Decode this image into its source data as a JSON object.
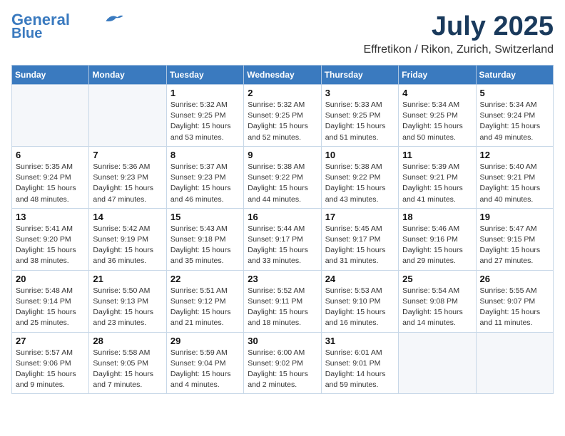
{
  "header": {
    "logo_line1": "General",
    "logo_line2": "Blue",
    "month": "July 2025",
    "location": "Effretikon / Rikon, Zurich, Switzerland"
  },
  "weekdays": [
    "Sunday",
    "Monday",
    "Tuesday",
    "Wednesday",
    "Thursday",
    "Friday",
    "Saturday"
  ],
  "weeks": [
    [
      {
        "day": "",
        "info": ""
      },
      {
        "day": "",
        "info": ""
      },
      {
        "day": "1",
        "info": "Sunrise: 5:32 AM\nSunset: 9:25 PM\nDaylight: 15 hours\nand 53 minutes."
      },
      {
        "day": "2",
        "info": "Sunrise: 5:32 AM\nSunset: 9:25 PM\nDaylight: 15 hours\nand 52 minutes."
      },
      {
        "day": "3",
        "info": "Sunrise: 5:33 AM\nSunset: 9:25 PM\nDaylight: 15 hours\nand 51 minutes."
      },
      {
        "day": "4",
        "info": "Sunrise: 5:34 AM\nSunset: 9:25 PM\nDaylight: 15 hours\nand 50 minutes."
      },
      {
        "day": "5",
        "info": "Sunrise: 5:34 AM\nSunset: 9:24 PM\nDaylight: 15 hours\nand 49 minutes."
      }
    ],
    [
      {
        "day": "6",
        "info": "Sunrise: 5:35 AM\nSunset: 9:24 PM\nDaylight: 15 hours\nand 48 minutes."
      },
      {
        "day": "7",
        "info": "Sunrise: 5:36 AM\nSunset: 9:23 PM\nDaylight: 15 hours\nand 47 minutes."
      },
      {
        "day": "8",
        "info": "Sunrise: 5:37 AM\nSunset: 9:23 PM\nDaylight: 15 hours\nand 46 minutes."
      },
      {
        "day": "9",
        "info": "Sunrise: 5:38 AM\nSunset: 9:22 PM\nDaylight: 15 hours\nand 44 minutes."
      },
      {
        "day": "10",
        "info": "Sunrise: 5:38 AM\nSunset: 9:22 PM\nDaylight: 15 hours\nand 43 minutes."
      },
      {
        "day": "11",
        "info": "Sunrise: 5:39 AM\nSunset: 9:21 PM\nDaylight: 15 hours\nand 41 minutes."
      },
      {
        "day": "12",
        "info": "Sunrise: 5:40 AM\nSunset: 9:21 PM\nDaylight: 15 hours\nand 40 minutes."
      }
    ],
    [
      {
        "day": "13",
        "info": "Sunrise: 5:41 AM\nSunset: 9:20 PM\nDaylight: 15 hours\nand 38 minutes."
      },
      {
        "day": "14",
        "info": "Sunrise: 5:42 AM\nSunset: 9:19 PM\nDaylight: 15 hours\nand 36 minutes."
      },
      {
        "day": "15",
        "info": "Sunrise: 5:43 AM\nSunset: 9:18 PM\nDaylight: 15 hours\nand 35 minutes."
      },
      {
        "day": "16",
        "info": "Sunrise: 5:44 AM\nSunset: 9:17 PM\nDaylight: 15 hours\nand 33 minutes."
      },
      {
        "day": "17",
        "info": "Sunrise: 5:45 AM\nSunset: 9:17 PM\nDaylight: 15 hours\nand 31 minutes."
      },
      {
        "day": "18",
        "info": "Sunrise: 5:46 AM\nSunset: 9:16 PM\nDaylight: 15 hours\nand 29 minutes."
      },
      {
        "day": "19",
        "info": "Sunrise: 5:47 AM\nSunset: 9:15 PM\nDaylight: 15 hours\nand 27 minutes."
      }
    ],
    [
      {
        "day": "20",
        "info": "Sunrise: 5:48 AM\nSunset: 9:14 PM\nDaylight: 15 hours\nand 25 minutes."
      },
      {
        "day": "21",
        "info": "Sunrise: 5:50 AM\nSunset: 9:13 PM\nDaylight: 15 hours\nand 23 minutes."
      },
      {
        "day": "22",
        "info": "Sunrise: 5:51 AM\nSunset: 9:12 PM\nDaylight: 15 hours\nand 21 minutes."
      },
      {
        "day": "23",
        "info": "Sunrise: 5:52 AM\nSunset: 9:11 PM\nDaylight: 15 hours\nand 18 minutes."
      },
      {
        "day": "24",
        "info": "Sunrise: 5:53 AM\nSunset: 9:10 PM\nDaylight: 15 hours\nand 16 minutes."
      },
      {
        "day": "25",
        "info": "Sunrise: 5:54 AM\nSunset: 9:08 PM\nDaylight: 15 hours\nand 14 minutes."
      },
      {
        "day": "26",
        "info": "Sunrise: 5:55 AM\nSunset: 9:07 PM\nDaylight: 15 hours\nand 11 minutes."
      }
    ],
    [
      {
        "day": "27",
        "info": "Sunrise: 5:57 AM\nSunset: 9:06 PM\nDaylight: 15 hours\nand 9 minutes."
      },
      {
        "day": "28",
        "info": "Sunrise: 5:58 AM\nSunset: 9:05 PM\nDaylight: 15 hours\nand 7 minutes."
      },
      {
        "day": "29",
        "info": "Sunrise: 5:59 AM\nSunset: 9:04 PM\nDaylight: 15 hours\nand 4 minutes."
      },
      {
        "day": "30",
        "info": "Sunrise: 6:00 AM\nSunset: 9:02 PM\nDaylight: 15 hours\nand 2 minutes."
      },
      {
        "day": "31",
        "info": "Sunrise: 6:01 AM\nSunset: 9:01 PM\nDaylight: 14 hours\nand 59 minutes."
      },
      {
        "day": "",
        "info": ""
      },
      {
        "day": "",
        "info": ""
      }
    ]
  ]
}
